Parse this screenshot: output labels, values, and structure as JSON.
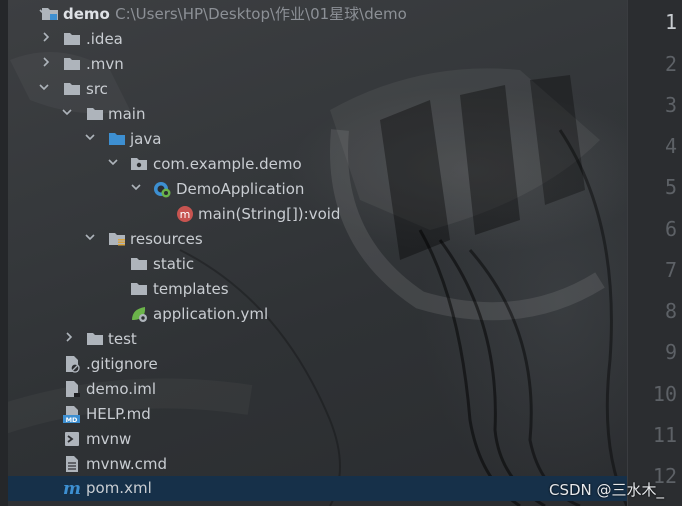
{
  "tree": {
    "root": {
      "name": "demo",
      "path": "C:\\Users\\HP\\Desktop\\作业\\01星球\\demo"
    },
    "idea": ".idea",
    "mvn": ".mvn",
    "src": "src",
    "main": "main",
    "java": "java",
    "package": "com.example.demo",
    "app_class": "DemoApplication",
    "main_method": "main(String[]):void",
    "resources": "resources",
    "static": "static",
    "templates": "templates",
    "app_yml": "application.yml",
    "test": "test",
    "gitignore": ".gitignore",
    "demo_iml": "demo.iml",
    "help_md": "HELP.md",
    "mvnw": "mvnw",
    "mvnw_cmd": "mvnw.cmd",
    "pom": "pom.xml"
  },
  "gutter_lines": [
    "1",
    "2",
    "3",
    "4",
    "5",
    "6",
    "7",
    "8",
    "9",
    "10",
    "11",
    "12"
  ],
  "watermark": "CSDN @三水木_",
  "icons": {
    "method_badge": "m",
    "md_badge": "MD",
    "pom_badge": "m"
  },
  "colors": {
    "selection": "#163049",
    "folder": "#aeb4bb",
    "source_folder": "#3d8fd1",
    "spring_green": "#6bb44a",
    "method_red": "#c75450"
  }
}
